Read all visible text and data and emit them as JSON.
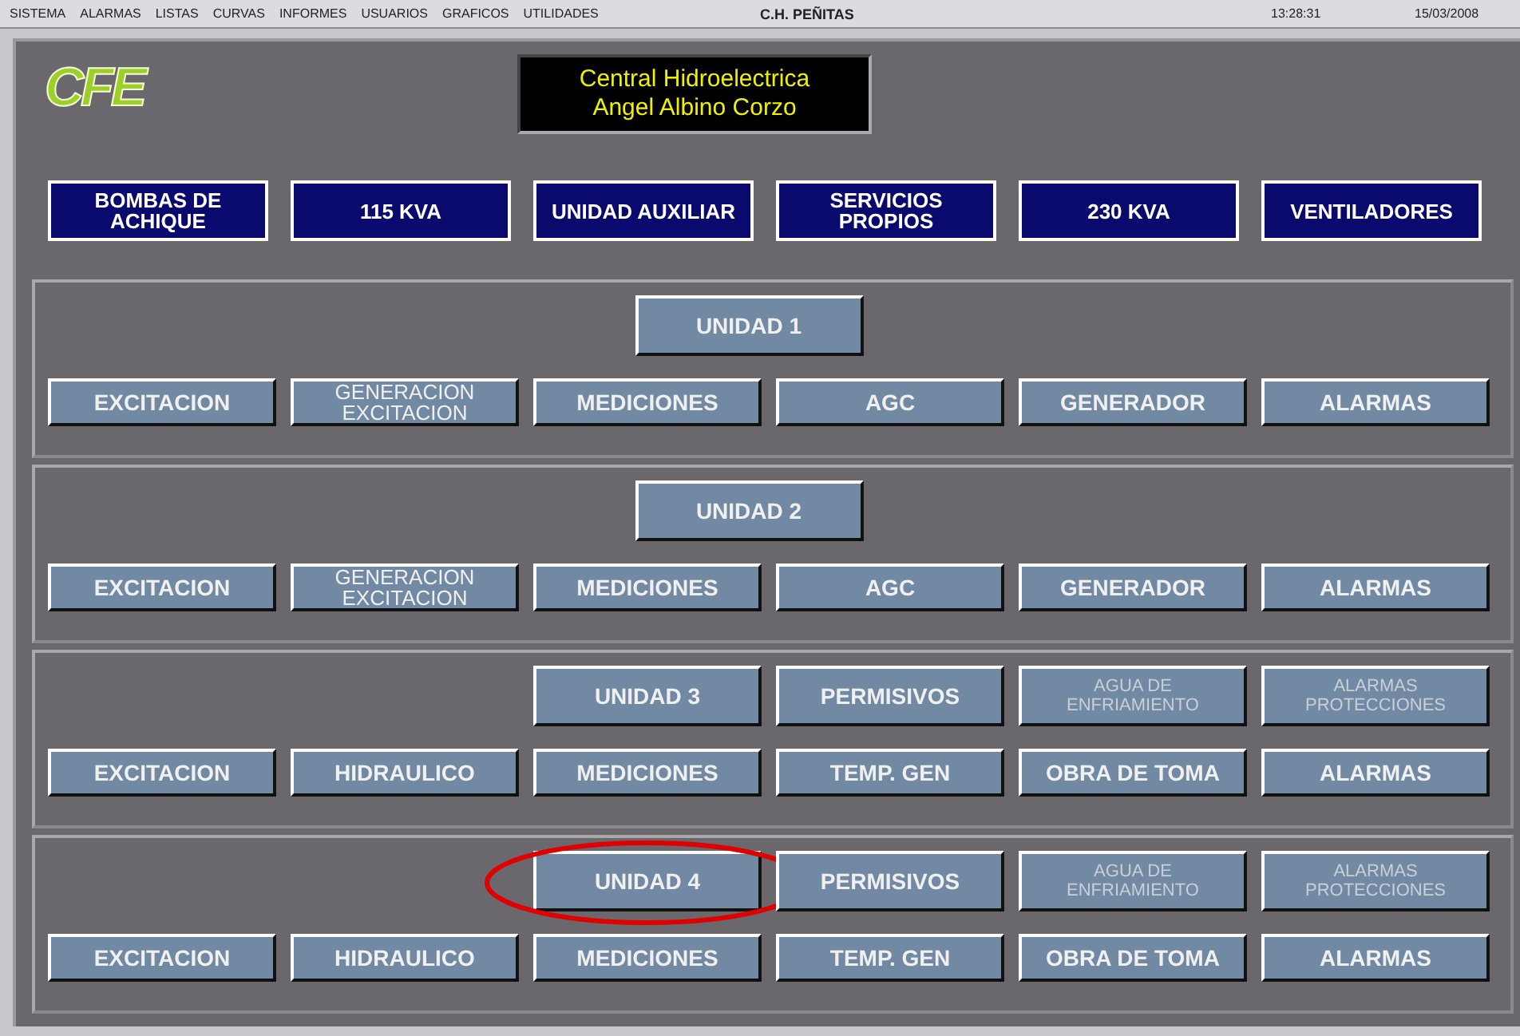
{
  "menu_bar": {
    "items": [
      "SISTEMA",
      "ALARMAS",
      "LISTAS",
      "CURVAS",
      "INFORMES",
      "USUARIOS",
      "GRAFICOS",
      "UTILIDADES"
    ],
    "station": "C.H. PEÑITAS",
    "time": "13:28:31",
    "date": "15/03/2008"
  },
  "logo": "CFE",
  "title": [
    "Central Hidroelectrica",
    "Angel Albino Corzo"
  ],
  "nav_buttons": [
    [
      "BOMBAS DE",
      "ACHIQUE"
    ],
    [
      "115 KVA"
    ],
    [
      "UNIDAD AUXILIAR"
    ],
    [
      "SERVICIOS",
      "PROPIOS"
    ],
    [
      "230 KVA"
    ],
    [
      "VENTILADORES"
    ]
  ],
  "units": [
    {
      "top": [
        {
          "label": [
            "UNIDAD 1"
          ],
          "disabled": false,
          "circled": false
        }
      ],
      "bottom": [
        [
          "EXCITACION"
        ],
        [
          "GENERACION",
          "EXCITACION"
        ],
        [
          "MEDICIONES"
        ],
        [
          "AGC"
        ],
        [
          "GENERADOR"
        ],
        [
          "ALARMAS"
        ]
      ]
    },
    {
      "top": [
        {
          "label": [
            "UNIDAD 2"
          ],
          "disabled": false,
          "circled": false
        }
      ],
      "bottom": [
        [
          "EXCITACION"
        ],
        [
          "GENERACION",
          "EXCITACION"
        ],
        [
          "MEDICIONES"
        ],
        [
          "AGC"
        ],
        [
          "GENERADOR"
        ],
        [
          "ALARMAS"
        ]
      ]
    },
    {
      "top": [
        {
          "label": [
            "UNIDAD 3"
          ],
          "disabled": false,
          "circled": false
        },
        {
          "label": [
            "PERMISIVOS"
          ],
          "disabled": false,
          "circled": false
        },
        {
          "label": [
            "AGUA DE",
            "ENFRIAMIENTO"
          ],
          "disabled": true,
          "circled": false
        },
        {
          "label": [
            "ALARMAS",
            "PROTECCIONES"
          ],
          "disabled": true,
          "circled": false
        }
      ],
      "bottom": [
        [
          "EXCITACION"
        ],
        [
          "HIDRAULICO"
        ],
        [
          "MEDICIONES"
        ],
        [
          "TEMP. GEN"
        ],
        [
          "OBRA DE TOMA"
        ],
        [
          "ALARMAS"
        ]
      ]
    },
    {
      "top": [
        {
          "label": [
            "UNIDAD 4"
          ],
          "disabled": false,
          "circled": true
        },
        {
          "label": [
            "PERMISIVOS"
          ],
          "disabled": false,
          "circled": false
        },
        {
          "label": [
            "AGUA DE",
            "ENFRIAMIENTO"
          ],
          "disabled": true,
          "circled": false
        },
        {
          "label": [
            "ALARMAS",
            "PROTECCIONES"
          ],
          "disabled": true,
          "circled": false
        }
      ],
      "bottom": [
        [
          "EXCITACION"
        ],
        [
          "HIDRAULICO"
        ],
        [
          "MEDICIONES"
        ],
        [
          "TEMP. GEN"
        ],
        [
          "OBRA DE TOMA"
        ],
        [
          "ALARMAS"
        ]
      ]
    }
  ]
}
